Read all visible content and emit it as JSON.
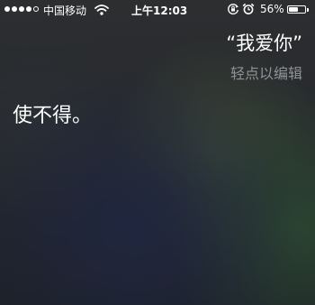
{
  "status_bar": {
    "signal_total": 5,
    "signal_filled": 4,
    "carrier": "中国移动",
    "time": "上午12:03",
    "battery_percent": "56%",
    "battery_level": 0.56,
    "icons": [
      "signal-dots-icon",
      "wifi-icon",
      "rotation-lock-icon",
      "alarm-icon",
      "battery-icon"
    ]
  },
  "siri": {
    "user_quote": "“我爱你”",
    "edit_hint": "轻点以编辑",
    "response": "使不得。"
  }
}
